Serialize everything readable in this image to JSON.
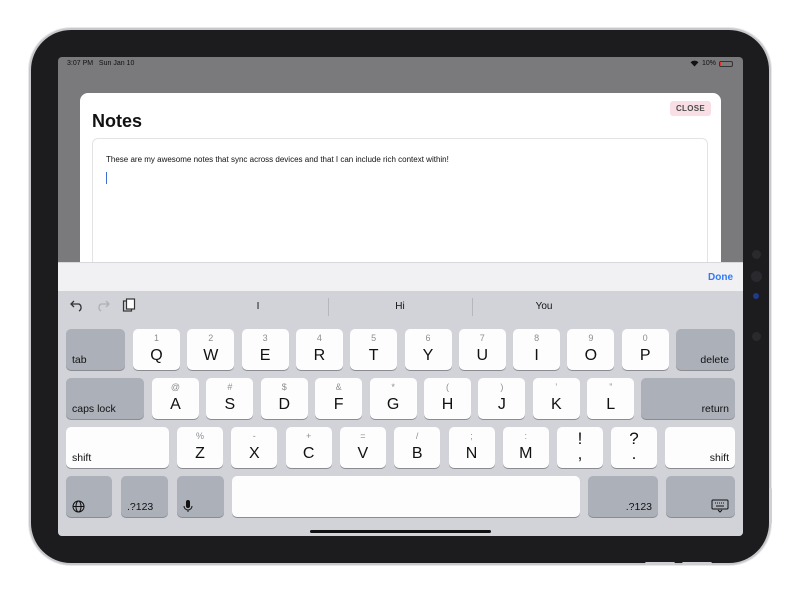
{
  "status": {
    "time": "3:07 PM",
    "date": "Sun Jan 10",
    "battery": "10%",
    "battery_level": 0.1,
    "battery_color": "#e0332c"
  },
  "modal": {
    "title": "Notes",
    "close_label": "CLOSE",
    "note_text": "These are my awesome notes that sync across devices and that I can include rich context within!"
  },
  "accessory": {
    "done_label": "Done"
  },
  "suggestions": {
    "icons": [
      "undo-icon",
      "redo-icon",
      "clipboard-icon"
    ],
    "words": [
      "I",
      "Hi",
      "You"
    ]
  },
  "keyboard": {
    "row1": [
      {
        "sec": "1",
        "pri": "Q"
      },
      {
        "sec": "2",
        "pri": "W"
      },
      {
        "sec": "3",
        "pri": "E"
      },
      {
        "sec": "4",
        "pri": "R"
      },
      {
        "sec": "5",
        "pri": "T"
      },
      {
        "sec": "6",
        "pri": "Y"
      },
      {
        "sec": "7",
        "pri": "U"
      },
      {
        "sec": "8",
        "pri": "I"
      },
      {
        "sec": "9",
        "pri": "O"
      },
      {
        "sec": "0",
        "pri": "P"
      }
    ],
    "row2": [
      {
        "sec": "@",
        "pri": "A"
      },
      {
        "sec": "#",
        "pri": "S"
      },
      {
        "sec": "$",
        "pri": "D"
      },
      {
        "sec": "&",
        "pri": "F"
      },
      {
        "sec": "*",
        "pri": "G"
      },
      {
        "sec": "(",
        "pri": "H"
      },
      {
        "sec": ")",
        "pri": "J"
      },
      {
        "sec": "’",
        "pri": "K"
      },
      {
        "sec": "”",
        "pri": "L"
      }
    ],
    "row3": [
      {
        "sec": "%",
        "pri": "Z"
      },
      {
        "sec": "-",
        "pri": "X"
      },
      {
        "sec": "+",
        "pri": "C"
      },
      {
        "sec": "=",
        "pri": "V"
      },
      {
        "sec": "/",
        "pri": "B"
      },
      {
        "sec": ";",
        "pri": "N"
      },
      {
        "sec": ":",
        "pri": "M"
      }
    ],
    "punct": [
      {
        "top": "!",
        "bot": ","
      },
      {
        "top": "?",
        "bot": "."
      }
    ],
    "tab_label": "tab",
    "delete_label": "delete",
    "caps_label": "caps lock",
    "return_label": "return",
    "shift_label": "shift",
    "numbers_label": ".?123"
  }
}
